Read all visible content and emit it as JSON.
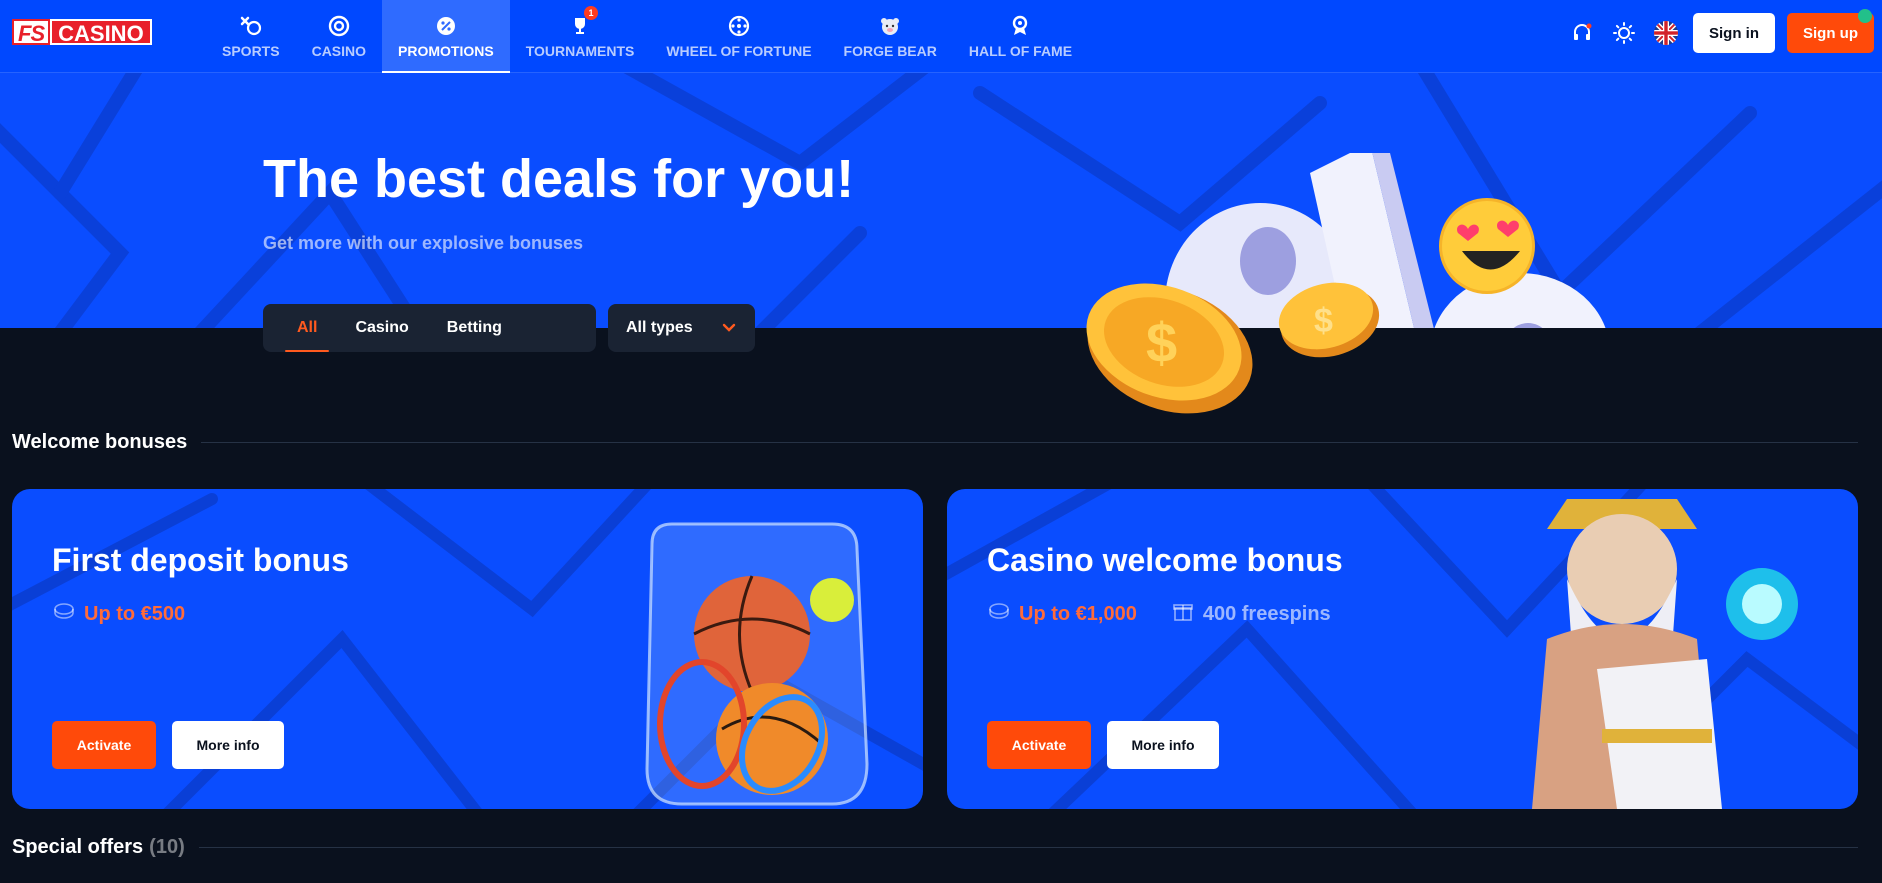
{
  "brand": {
    "logo_left": "FS",
    "logo_right": "CASINO"
  },
  "nav": {
    "items": [
      {
        "label": "SPORTS",
        "icon": "sports-icon"
      },
      {
        "label": "CASINO",
        "icon": "chip-icon"
      },
      {
        "label": "PROMOTIONS",
        "icon": "percent-badge-icon",
        "active": true
      },
      {
        "label": "TOURNAMENTS",
        "icon": "trophy-icon",
        "badge": "1"
      },
      {
        "label": "WHEEL OF FORTUNE",
        "icon": "wheel-icon"
      },
      {
        "label": "FORGE BEAR",
        "icon": "bear-icon"
      },
      {
        "label": "HALL OF FAME",
        "icon": "medal-icon"
      }
    ]
  },
  "header": {
    "support_icon": "headset-icon",
    "theme_icon": "sun-icon",
    "language_icon": "uk-flag-icon",
    "signin_label": "Sign in",
    "signup_label": "Sign up"
  },
  "hero": {
    "title": "The best deals for you!",
    "subtitle": "Get more with our explosive bonuses"
  },
  "filters": {
    "tabs": [
      {
        "label": "All",
        "active": true
      },
      {
        "label": "Casino"
      },
      {
        "label": "Betting"
      }
    ],
    "type_select": "All types"
  },
  "sections": {
    "welcome": {
      "title": "Welcome bonuses"
    },
    "special": {
      "title": "Special offers",
      "count": "(10)"
    }
  },
  "cards": [
    {
      "title": "First deposit bonus",
      "amount": "Up to €500",
      "activate_label": "Activate",
      "more_label": "More info"
    },
    {
      "title": "Casino welcome bonus",
      "amount": "Up to €1,000",
      "freespins": "400 freespins",
      "activate_label": "Activate",
      "more_label": "More info"
    }
  ],
  "colors": {
    "brand_blue": "#0048ff",
    "accent_orange": "#ff4a0a",
    "page_bg": "#0a111e",
    "panel_bg": "#1a2333"
  }
}
